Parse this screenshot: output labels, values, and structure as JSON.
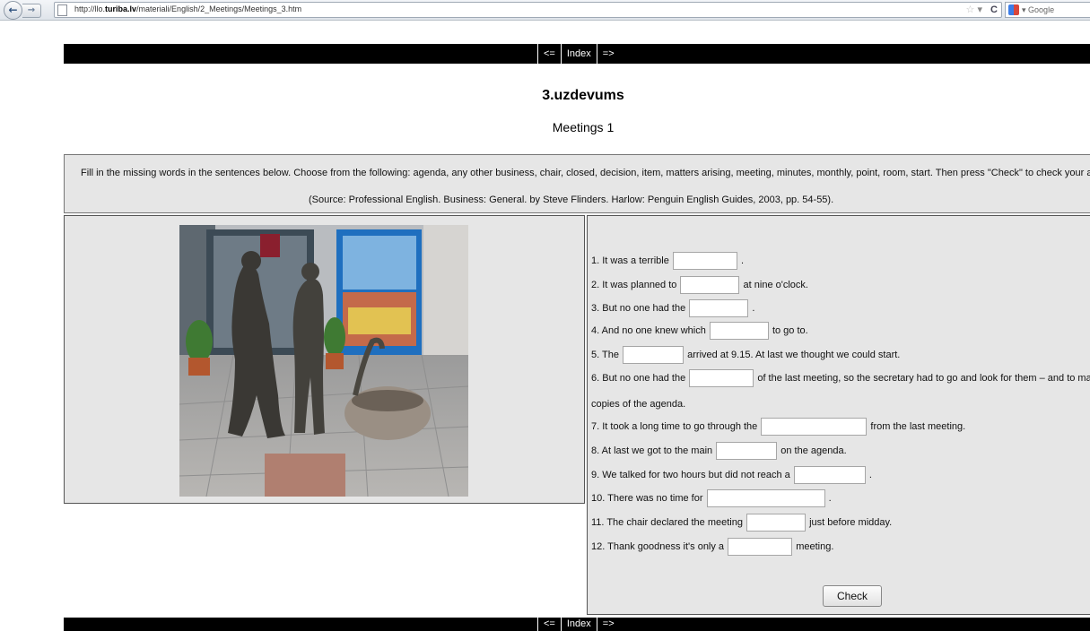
{
  "browser": {
    "back_icon": "back-arrow-icon",
    "forward_icon": "forward-arrow-icon",
    "url_prefix": "http://llo.",
    "url_bold": "turiba.lv",
    "url_suffix": "/materiali/English/2_Meetings/Meetings_3.htm",
    "search_placeholder": "Google"
  },
  "nav": {
    "prev": "<=",
    "index": "Index",
    "next": "=>"
  },
  "page": {
    "title": "3.uzdevums",
    "subtitle": "Meetings 1"
  },
  "instructions": {
    "line1": "Fill in the missing words in the sentences below. Choose from the following: agenda, any other business, chair, closed, decision, item, matters arising, meeting, minutes, monthly, point, room, start. Then press \"Check\" to check your answers.",
    "line2": "(Source: Professional English. Business: General. by Steve Flinders. Harlow: Penguin English Guides, 2003, pp. 54-55)."
  },
  "exercise": {
    "s1_a": "1. It was a terrible",
    "s1_b": ".",
    "s2_a": "2. It was planned to",
    "s2_b": "at nine o'clock.",
    "s3_a": "3. But no one had the",
    "s3_b": ".",
    "s4_a": "4. And no one knew which",
    "s4_b": "to go to.",
    "s5_a": "5. The",
    "s5_b": "arrived at 9.15. At last we thought we could start.",
    "s6_a": "6. But no one had the",
    "s6_b": "of the last meeting, so the secretary had to go and look for them – and to make",
    "s6_c": "copies of the agenda.",
    "s7_a": "7. It took a long time to go through the",
    "s7_b": "from the last meeting.",
    "s8_a": "8. At last we got to the main",
    "s8_b": "on the agenda.",
    "s9_a": "9. We talked for two hours but did not reach a",
    "s9_b": ".",
    "s10_a": "10. There was no time for",
    "s10_b": ".",
    "s11_a": "11. The chair declared the meeting",
    "s11_b": "just before midday.",
    "s12_a": "12. Thank goodness it's only a",
    "s12_b": "meeting.",
    "check_label": "Check"
  }
}
